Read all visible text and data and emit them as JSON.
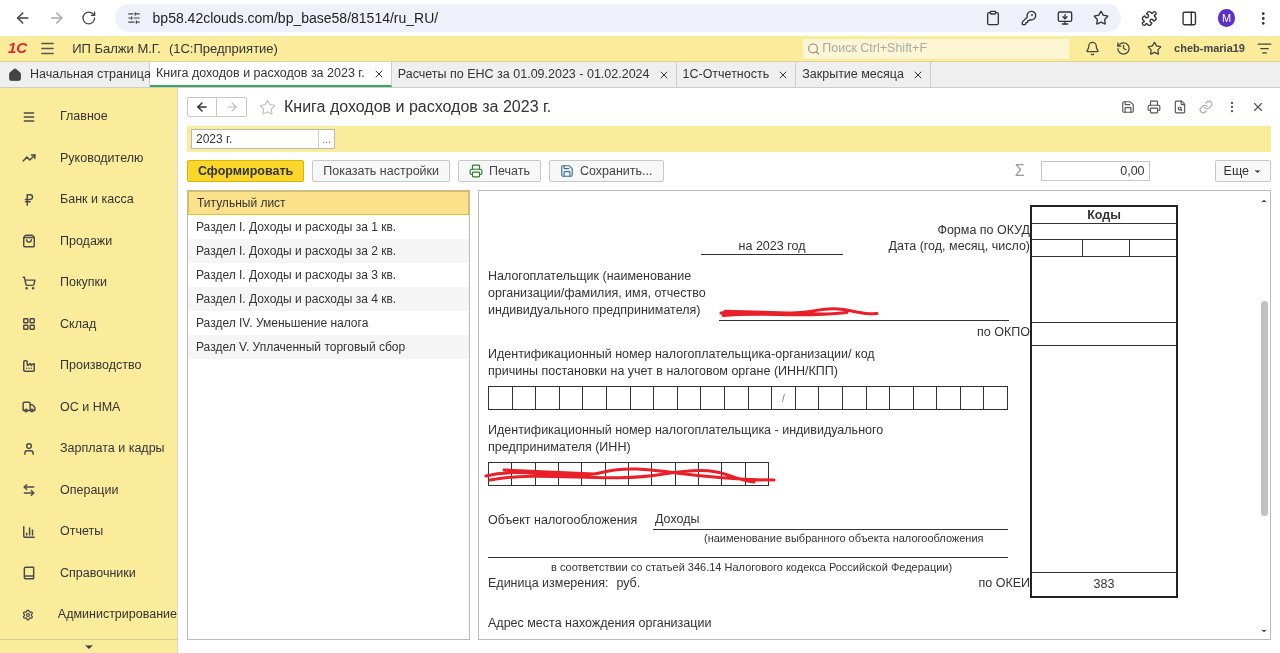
{
  "browser": {
    "url": "bp58.42clouds.com/bp_base58/81514/ru_RU/",
    "avatar": "M"
  },
  "app": {
    "logo": "1С",
    "org": "ИП Балжи М.Г.",
    "product": "(1С:Предприятие)",
    "search_placeholder": "Поиск Ctrl+Shift+F",
    "user": "cheb-maria19"
  },
  "home_tab": "Начальная страница",
  "tabs": [
    {
      "label": "Книга доходов и расходов за 2023 г.",
      "selected": true
    },
    {
      "label": "Расчеты по ЕНС за 01.09.2023 - 01.02.2024",
      "selected": false
    },
    {
      "label": "1С-Отчетность",
      "selected": false
    },
    {
      "label": "Закрытие месяца",
      "selected": false
    }
  ],
  "sidebar": [
    "Главное",
    "Руководителю",
    "Банк и касса",
    "Продажи",
    "Покупки",
    "Склад",
    "Производство",
    "ОС и НМА",
    "Зарплата и кадры",
    "Операции",
    "Отчеты",
    "Справочники",
    "Администрирование"
  ],
  "document": {
    "title": "Книга доходов и расходов за 2023 г.",
    "period": "2023 г.",
    "period_button": "...",
    "buttons": [
      {
        "label": "Сформировать",
        "kind": "primary"
      },
      {
        "label": "Показать настройки",
        "kind": "plain"
      },
      {
        "label": "Печать",
        "kind": "print"
      },
      {
        "label": "Сохранить...",
        "kind": "save"
      }
    ],
    "sigma": "Σ",
    "total": "0,00",
    "more": "Еще"
  },
  "sections": [
    {
      "label": "Титульный лист",
      "selected": true
    },
    {
      "label": "Раздел I. Доходы и расходы за 1 кв.",
      "selected": false
    },
    {
      "label": "Раздел I. Доходы и расходы за 2 кв.",
      "selected": false
    },
    {
      "label": "Раздел I. Доходы и расходы за 3 кв.",
      "selected": false
    },
    {
      "label": "Раздел I. Доходы и расходы за 4 кв.",
      "selected": false
    },
    {
      "label": "Раздел IV. Уменьшение налога",
      "selected": false
    },
    {
      "label": "Раздел V. Уплаченный торговый сбор",
      "selected": false
    }
  ],
  "report": {
    "codes_header": "Коды",
    "okud_label": "Форма по ОКУД",
    "date_label": "Дата (год, месяц, число)",
    "year_text": "на 2023 год",
    "taxpayer_label": "Налогоплательщик (наименование организации/фамилия, имя, отчество индивидуального предпринимателя)",
    "okpo_label": "по ОКПО",
    "inn_kpp_label": "Идентификационный номер налогоплательщика-организации/ код причины постановки на учет в налоговом органе (ИНН/КПП)",
    "kpp_separator": "/",
    "inn_label": "Идентификационный номер налогоплательщика - индивидуального предпринимателя (ИНН)",
    "object_label": "Объект налогообложения",
    "object_value": "Доходы",
    "object_note_1": "(наименование выбранного объекта налогообложения",
    "object_note_2": "в соответствии со статьей 346.14 Налогового кодекса Российской Федерации)",
    "unit_label": "Единица измерения:",
    "unit_value": "руб.",
    "okei_label": "по ОКЕИ",
    "okei_value": "383",
    "address_label": "Адрес места нахождения организации"
  }
}
